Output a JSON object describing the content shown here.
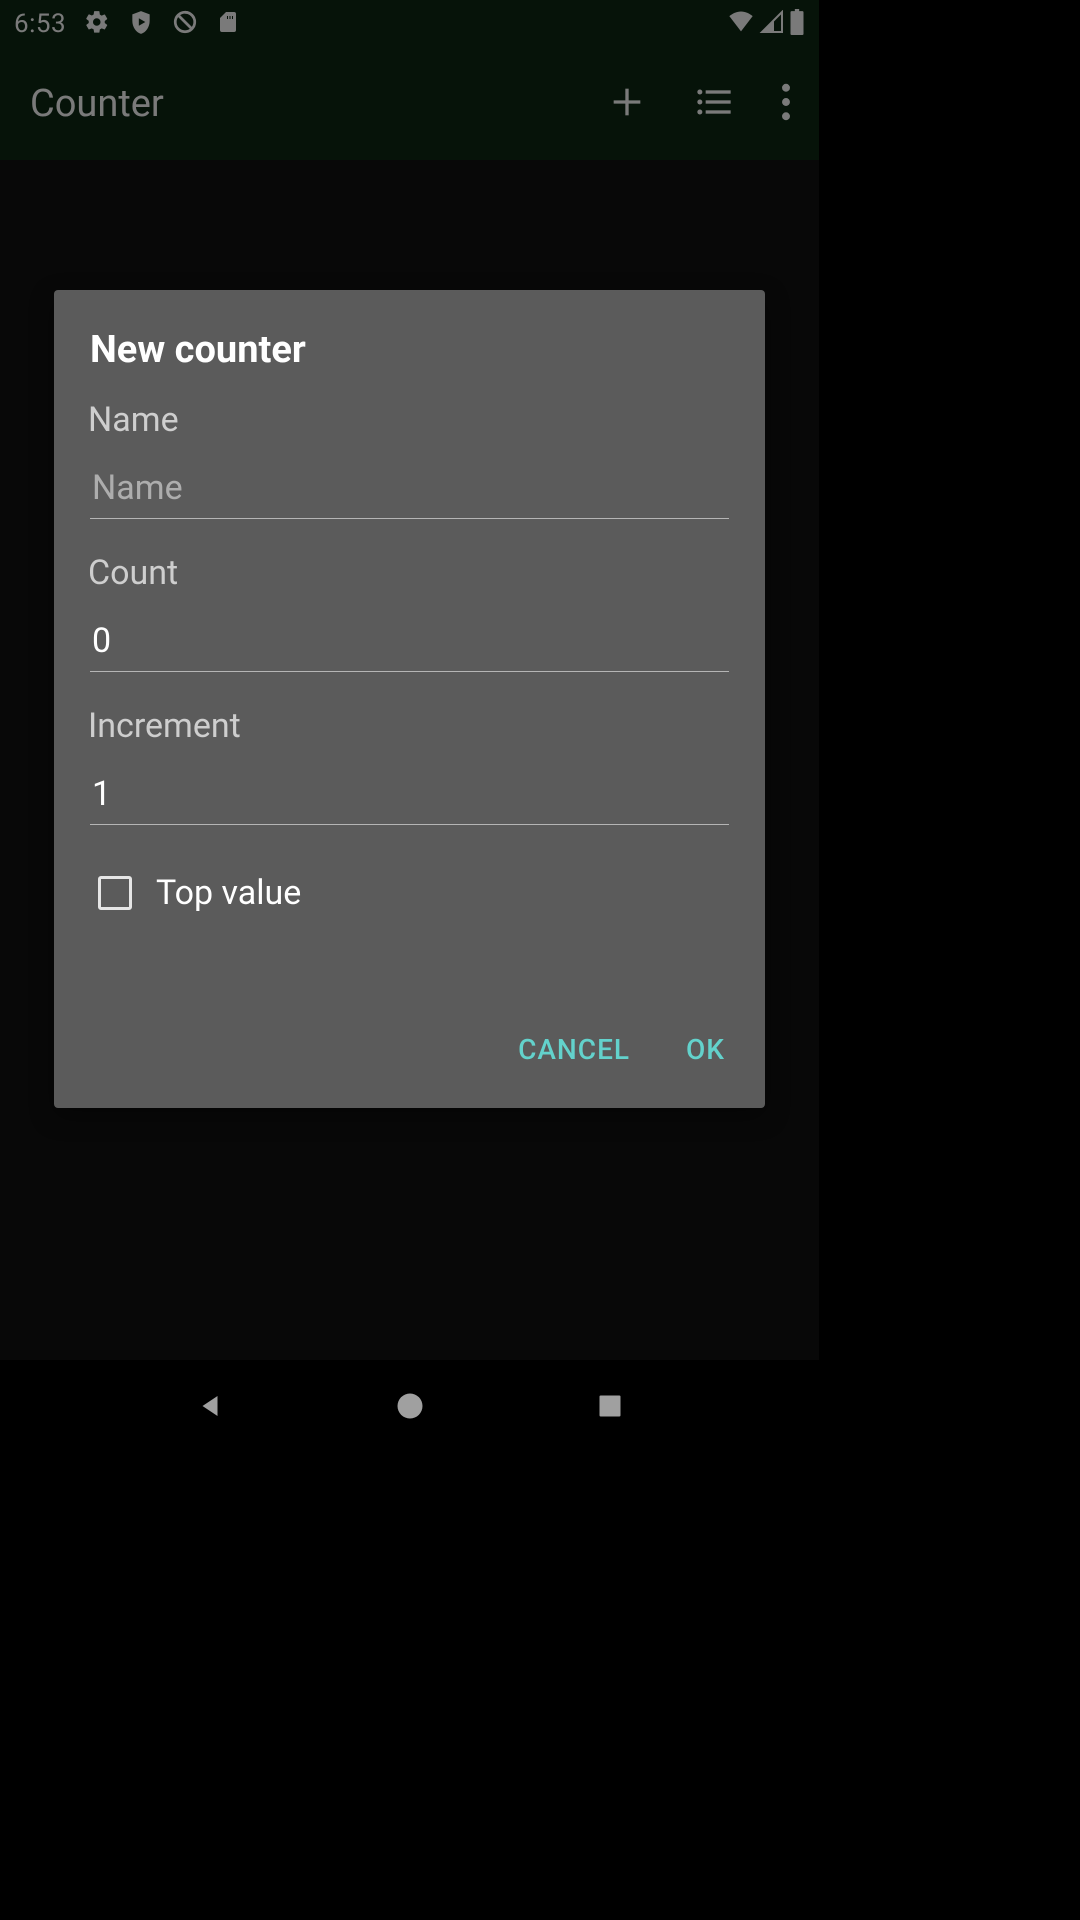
{
  "status": {
    "time": "6:53"
  },
  "appbar": {
    "title": "Counter"
  },
  "dialog": {
    "title": "New counter",
    "name_label": "Name",
    "name_placeholder": "Name",
    "name_value": "",
    "count_label": "Count",
    "count_value": "0",
    "increment_label": "Increment",
    "increment_value": "1",
    "topvalue_label": "Top value",
    "topvalue_checked": false,
    "cancel_label": "Cancel",
    "ok_label": "OK"
  }
}
